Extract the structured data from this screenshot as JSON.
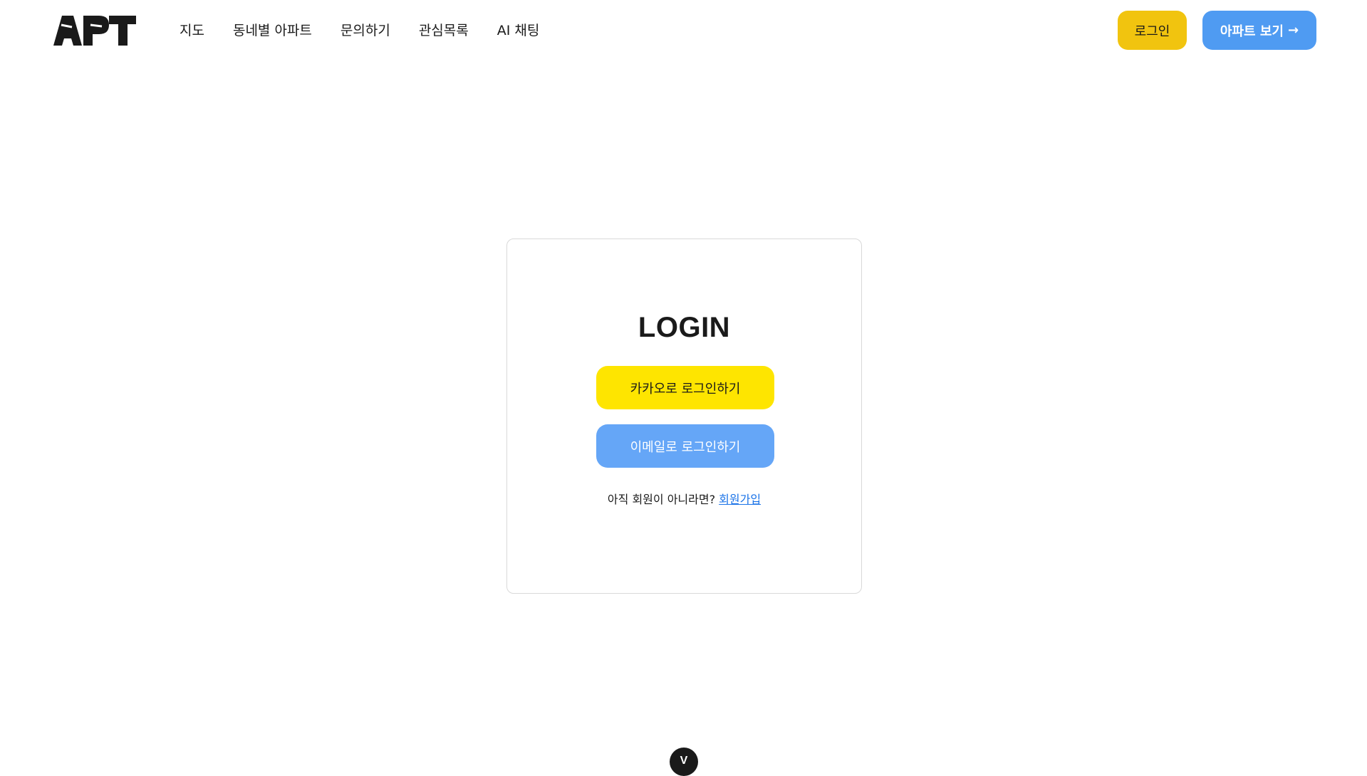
{
  "header": {
    "logo_text": "APT",
    "nav": [
      {
        "label": "지도"
      },
      {
        "label": "동네별 아파트"
      },
      {
        "label": "문의하기"
      },
      {
        "label": "관심목록"
      },
      {
        "label": "AI 채팅"
      }
    ],
    "login_button": "로그인",
    "view_apt_button": "아파트 보기",
    "view_apt_icon": "arrow-right-icon"
  },
  "login": {
    "title": "LOGIN",
    "kakao_button": "카카오로 로그인하기",
    "email_button": "이메일로 로그인하기",
    "signup_prompt": "아직 회원이 아니라면?",
    "signup_link": "회원가입"
  },
  "scroll_indicator": {
    "icon": "chevron-down-icon",
    "glyph": "V"
  },
  "colors": {
    "header_login_bg": "#f1c40f",
    "view_apt_bg": "#4f9bf2",
    "kakao_bg": "#fee500",
    "email_bg": "#65a6f7",
    "link": "#1a73e8"
  }
}
